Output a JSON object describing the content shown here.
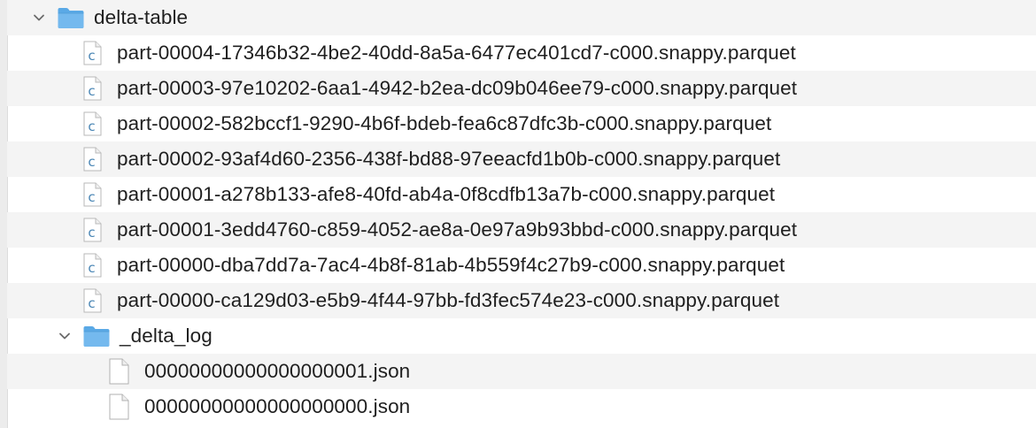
{
  "root_folder": {
    "name": "delta-table",
    "icon": "folder-icon",
    "expanded": true,
    "folder_color": "#5aa9e6"
  },
  "parquet_files": [
    {
      "name": "part-00004-17346b32-4be2-40dd-8a5a-6477ec401cd7-c000.snappy.parquet",
      "icon": "c-source-file-icon"
    },
    {
      "name": "part-00003-97e10202-6aa1-4942-b2ea-dc09b046ee79-c000.snappy.parquet",
      "icon": "c-source-file-icon"
    },
    {
      "name": "part-00002-582bccf1-9290-4b6f-bdeb-fea6c87dfc3b-c000.snappy.parquet",
      "icon": "c-source-file-icon"
    },
    {
      "name": "part-00002-93af4d60-2356-438f-bd88-97eeacfd1b0b-c000.snappy.parquet",
      "icon": "c-source-file-icon"
    },
    {
      "name": "part-00001-a278b133-afe8-40fd-ab4a-0f8cdfb13a7b-c000.snappy.parquet",
      "icon": "c-source-file-icon"
    },
    {
      "name": "part-00001-3edd4760-c859-4052-ae8a-0e97a9b93bbd-c000.snappy.parquet",
      "icon": "c-source-file-icon"
    },
    {
      "name": "part-00000-dba7dd7a-7ac4-4b8f-81ab-4b559f4c27b9-c000.snappy.parquet",
      "icon": "c-source-file-icon"
    },
    {
      "name": "part-00000-ca129d03-e5b9-4f44-97bb-fd3fec574e23-c000.snappy.parquet",
      "icon": "c-source-file-icon"
    }
  ],
  "log_folder": {
    "name": "_delta_log",
    "icon": "folder-icon",
    "expanded": true
  },
  "log_files": [
    {
      "name": "00000000000000000001.json",
      "icon": "document-icon"
    },
    {
      "name": "00000000000000000000.json",
      "icon": "document-icon"
    }
  ],
  "colors": {
    "row_alt": "#f4f4f4",
    "text": "#1f1f1f",
    "c_icon_letter": "#4a86b5"
  }
}
